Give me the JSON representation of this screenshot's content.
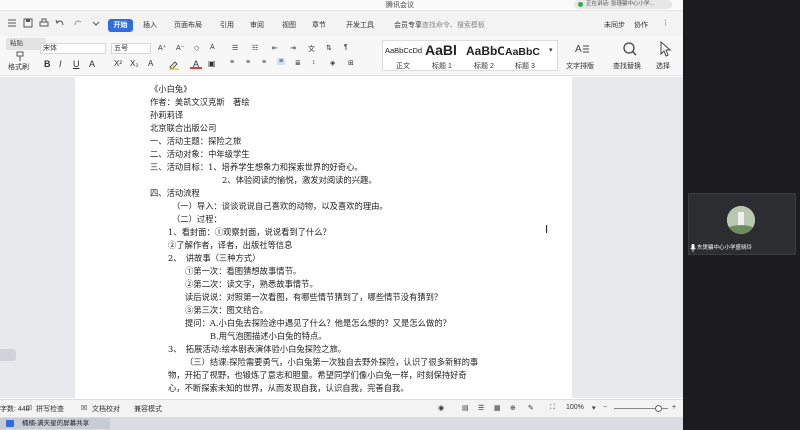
{
  "window": {
    "title": "腾讯会议",
    "meeting_indicator": "正在讲话: 张瑾骗中心小学...",
    "minimize": "—",
    "maximize": "☐",
    "close": "✕"
  },
  "menu": {
    "items": [
      "开始",
      "插入",
      "页面布局",
      "引用",
      "审阅",
      "视图",
      "章节",
      "开发工具",
      "会员专享"
    ],
    "search_placeholder": "查找命令、搜索模板",
    "sync": "未同步",
    "collab": "协作"
  },
  "ribbon": {
    "format_painter": "格式刷",
    "paste": "粘贴",
    "font_name": "宋体",
    "font_size": "五号",
    "styles": [
      {
        "preview": "AaBbCcDd",
        "label": "正文"
      },
      {
        "preview": "AaBl",
        "label": "标题 1"
      },
      {
        "preview": "AaBbC",
        "label": "标题 2"
      },
      {
        "preview": "AaBbC",
        "label": "标题 3"
      }
    ],
    "text_layout": "文字排版",
    "find_replace": "查找替换",
    "select": "选择"
  },
  "document": {
    "lines": [
      "《小白兔》",
      "作者：美凯文汉克斯　著绘",
      "孙莉莉译",
      "北京联合出版公司",
      "一、活动主题：探险之旅",
      "二、活动对象：中年级学生",
      "三、活动目标：1、培养学生想象力和探索世界的好奇心。",
      "2、体验阅读的愉悦，激发对阅读的兴趣。",
      "四、活动流程",
      "（一）导入：谈谈说说自己喜欢的动物，以及喜欢的理由。",
      "（二）过程：",
      "1、看封面：①观察封面，说说看到了什么？",
      "②了解作者，译者，出版社等信息",
      "2、　讲故事（三种方式）",
      "①第一次：看图猜想故事情节。",
      "②第二次：读文字，熟悉故事情节。",
      "读后说说：对照第一次看图，有哪些情节猜到了，哪些情节没有猜到？",
      "③第三次：图文结合。",
      "提问：A.小白兔去探险途中遇见了什么？他是怎么想的？又是怎么做的？",
      "B.用气泡图描述小白兔的特点。",
      "3、　拓展活动:绘本剧表演体验小白兔探险之旅。",
      "（三）结课:探险需要勇气，小白兔第一次独自去野外探险，认识了很多新鲜的事",
      "物，开拓了视野，也锻炼了意志和胆量。希望同学们像小白兔一样，时刻保持好奇",
      "心，不断探索未知的世界，从而发现自我，认识自我，完善自我。"
    ]
  },
  "status": {
    "word_count": "字数: 440",
    "spell_check": "拼写检查",
    "doc_proof": "文档校对",
    "compat_mode": "兼容模式",
    "zoom": "100%",
    "zoom_level": 1.0
  },
  "taskbar": {
    "item": "楠楠-满天星的屏幕共享"
  },
  "meeting": {
    "participant_name": "东煲骗中心小学盛晓玲"
  },
  "colors": {
    "accent": "#2f6de1",
    "panel_bg": "#1c1c1e"
  }
}
